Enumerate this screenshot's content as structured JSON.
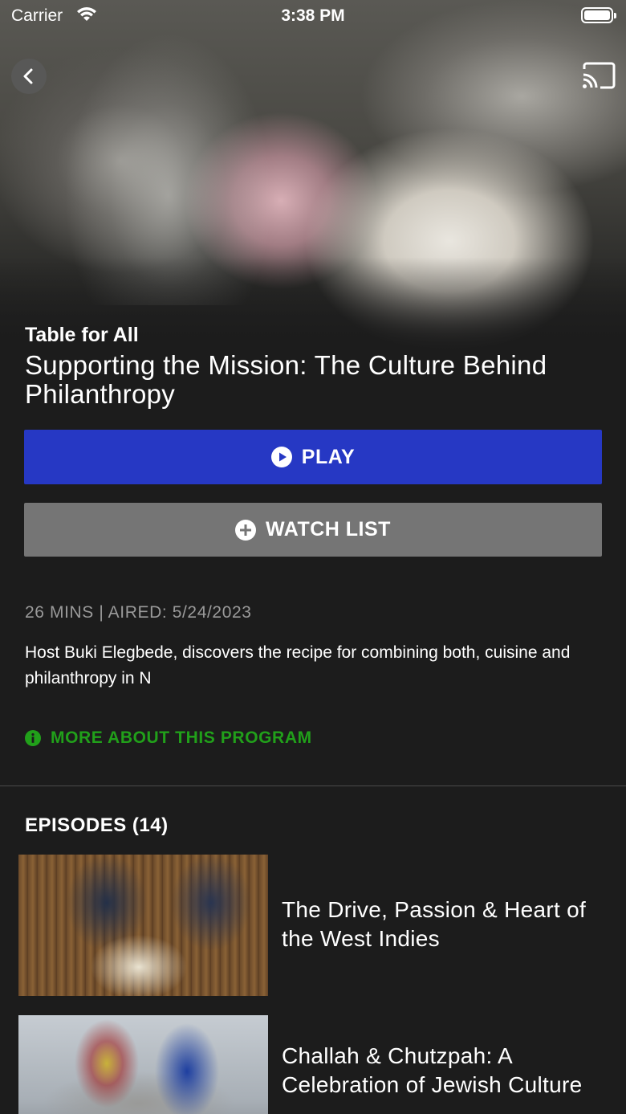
{
  "status_bar": {
    "carrier": "Carrier",
    "time": "3:38 PM"
  },
  "hero": {
    "show_title": "Table for All",
    "episode_title": "Supporting the Mission: The Culture Behind Philanthropy"
  },
  "actions": {
    "play_label": "PLAY",
    "watchlist_label": "WATCH LIST"
  },
  "details": {
    "meta": "26 MINS | AIRED: 5/24/2023",
    "description": "Host Buki Elegbede, discovers the recipe for combining both, cuisine and philanthropy in N",
    "more_label": "MORE ABOUT THIS PROGRAM"
  },
  "episodes": {
    "header": "EPISODES (14)",
    "items": [
      {
        "title": "The Drive, Passion & Heart of the West Indies"
      },
      {
        "title": "Challah & Chutzpah: A Celebration of Jewish Culture"
      }
    ]
  },
  "colors": {
    "background": "#1c1c1c",
    "play_button": "#2638c4",
    "watchlist_button": "#757575",
    "link_green": "#21a01a",
    "meta_gray": "#9a9a9a"
  },
  "icons": [
    "wifi-icon",
    "battery-icon",
    "back-chevron-icon",
    "cast-icon",
    "play-circle-icon",
    "plus-circle-icon",
    "info-icon"
  ]
}
